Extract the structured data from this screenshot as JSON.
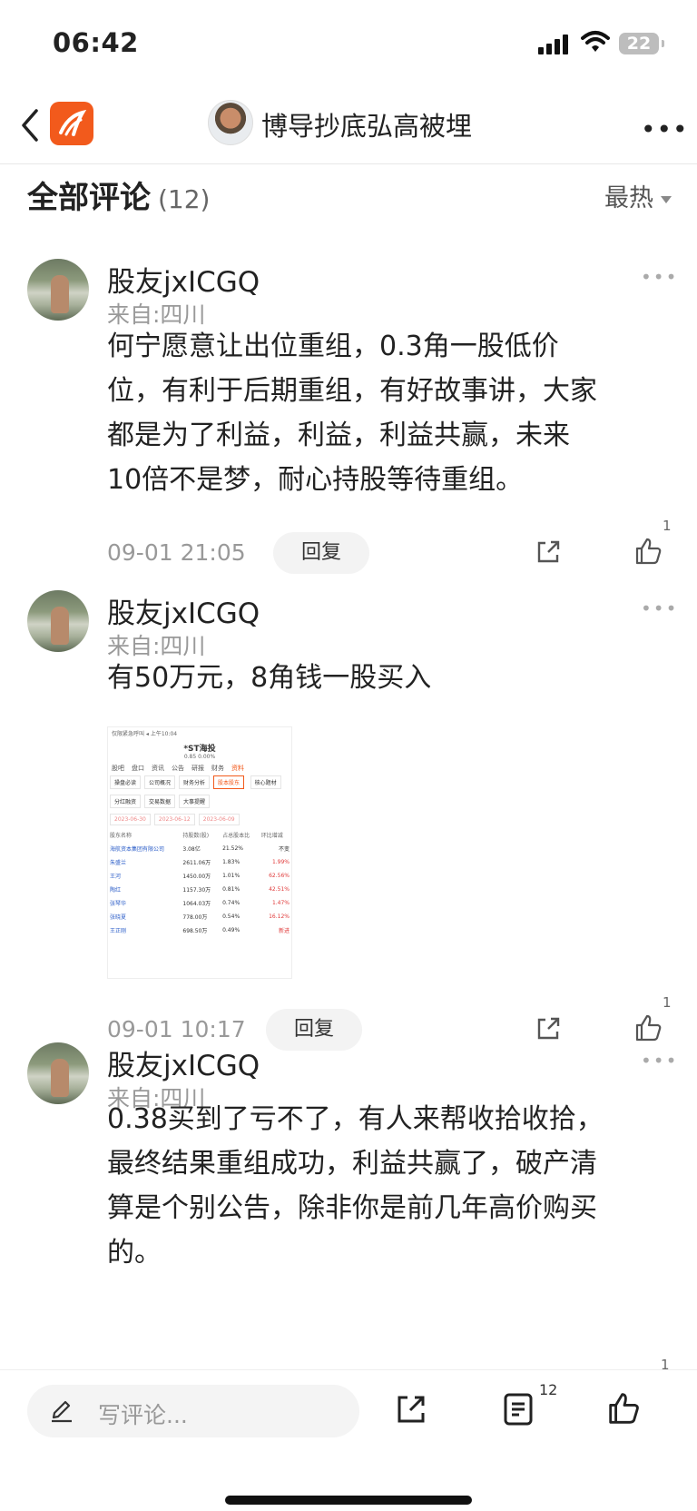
{
  "status": {
    "time": "06:42",
    "battery": "22"
  },
  "nav": {
    "title": "博导抄底弘高被埋",
    "more": "•••"
  },
  "section": {
    "title": "全部评论",
    "count": "(12)",
    "sort": "最热"
  },
  "comments": [
    {
      "user": "股友jxICGQ",
      "location": "来自:四川",
      "text": [
        "何宁愿意让出位重组，0.3角一股低价",
        "位，有利于后期重组，有好故事讲，大家",
        "都是为了利益，利益，利益共赢，未来",
        "10倍不是梦，耐心持股等待重组。"
      ],
      "time": "09-01 21:05",
      "reply": "回复",
      "likes": "1"
    },
    {
      "user": "股友jxICGQ",
      "location": "来自:四川",
      "text": [
        "有50万元，8角钱一股买入"
      ],
      "time": "09-01 10:17",
      "reply": "回复",
      "likes": "1"
    },
    {
      "user": "股友jxICGQ",
      "location": "来自:四川",
      "text": [
        "0.38买到了亏不了，有人来帮收拾收拾，",
        "最终结果重组成功，利益共赢了，破产清",
        "算是个别公告，除非你是前几年高价购买",
        "的。"
      ],
      "likes": "1"
    }
  ],
  "screenshot": {
    "status": "仅限紧急呼叫 ◂ 上午10:04",
    "stock": "*ST海投",
    "price": "0.85  0.00%",
    "tabs": [
      "股吧",
      "盘口",
      "资讯",
      "公告",
      "研报",
      "财务",
      "资料"
    ],
    "buttons": [
      "操盘必读",
      "公司概况",
      "财务分析",
      "股本股东",
      "核心题材",
      "分红融资",
      "交易数据",
      "大事提醒"
    ],
    "dates": [
      "2023-06-30",
      "2023-06-12",
      "2023-06-09"
    ],
    "header": [
      "股东名称",
      "持股数(股)",
      "占总股本比",
      "环比增减"
    ],
    "rows": [
      [
        "海航资本集团有限公司",
        "3.08亿",
        "21.52%",
        "不变"
      ],
      [
        "朱盛兰",
        "2611.06万",
        "1.83%",
        "1.99%"
      ],
      [
        "王河",
        "1450.00万",
        "1.01%",
        "62.56%"
      ],
      [
        "陶红",
        "1157.30万",
        "0.81%",
        "42.51%"
      ],
      [
        "张琴华",
        "1064.03万",
        "0.74%",
        "1.47%"
      ],
      [
        "张晓夏",
        "778.00万",
        "0.54%",
        "16.12%"
      ],
      [
        "王正刚",
        "698.50万",
        "0.49%",
        "新进"
      ]
    ]
  },
  "bottom": {
    "placeholder": "写评论...",
    "comment_count": "12"
  }
}
